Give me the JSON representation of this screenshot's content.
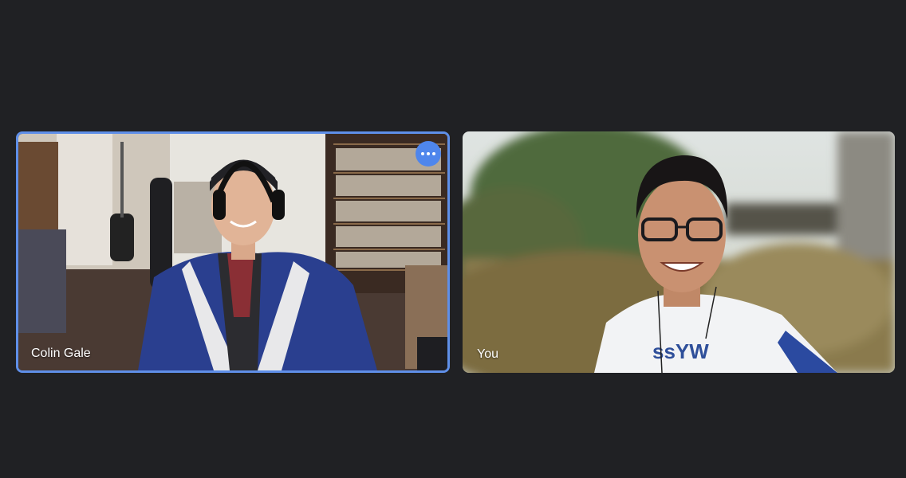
{
  "participants": [
    {
      "name": "Colin Gale",
      "active_speaker": true
    },
    {
      "name": "You",
      "active_speaker": false
    }
  ],
  "controls": {
    "more_options_icon": "more-horizontal-icon"
  },
  "colors": {
    "background": "#202124",
    "active_border": "#5f8fe8",
    "more_button": "#4f86ec"
  }
}
